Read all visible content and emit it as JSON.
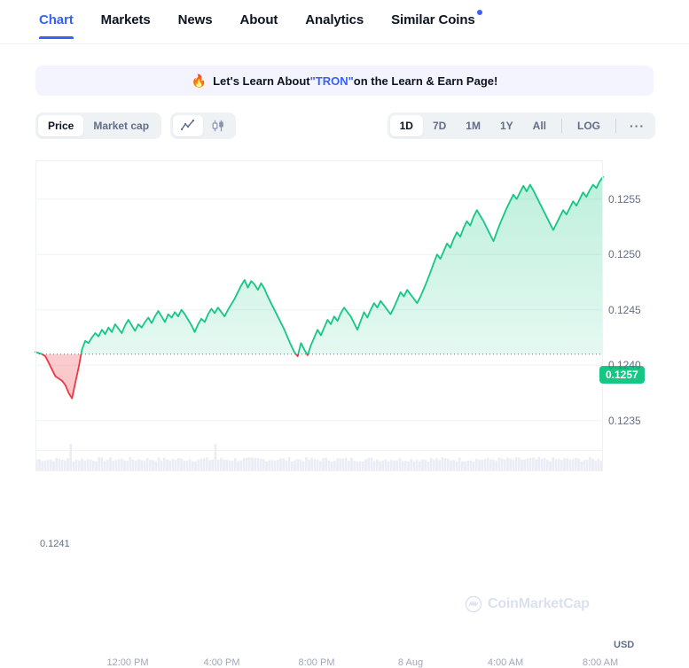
{
  "tabs": [
    {
      "label": "Chart",
      "active": true,
      "dot": false
    },
    {
      "label": "Markets",
      "active": false,
      "dot": false
    },
    {
      "label": "News",
      "active": false,
      "dot": false
    },
    {
      "label": "About",
      "active": false,
      "dot": false
    },
    {
      "label": "Analytics",
      "active": false,
      "dot": false
    },
    {
      "label": "Similar Coins",
      "active": false,
      "dot": true
    }
  ],
  "banner": {
    "icon": "flame-icon",
    "flame": "🔥",
    "text_before": "Let's Learn About ",
    "highlight": "\"TRON\"",
    "text_after": " on the Learn & Earn Page!"
  },
  "toolbar": {
    "metric_options": [
      {
        "label": "Price",
        "active": true
      },
      {
        "label": "Market cap",
        "active": false
      }
    ],
    "chart_type_options": [
      {
        "name": "line-chart-icon",
        "active": true
      },
      {
        "name": "candlestick-chart-icon",
        "active": false
      }
    ],
    "ranges": [
      {
        "label": "1D",
        "active": true
      },
      {
        "label": "7D",
        "active": false
      },
      {
        "label": "1M",
        "active": false
      },
      {
        "label": "1Y",
        "active": false
      },
      {
        "label": "All",
        "active": false
      }
    ],
    "log_label": "LOG",
    "more_label": "···"
  },
  "chart_data": {
    "type": "line",
    "title": "",
    "xlabel": "",
    "ylabel": "USD",
    "currency_label": "USD",
    "current_price_badge": "0.1257",
    "baseline_label": "0.1241",
    "baseline_value": 0.1241,
    "ylim": [
      0.12325,
      0.12585
    ],
    "grid": true,
    "legend_position": "none",
    "ytick_labels": [
      "0.1235",
      "0.1240",
      "0.1245",
      "0.1250",
      "0.1255"
    ],
    "ytick_values": [
      0.1235,
      0.124,
      0.1245,
      0.125,
      0.1255
    ],
    "xtick_labels": [
      "12:00 PM",
      "4:00 PM",
      "8:00 PM",
      "8 Aug",
      "4:00 AM",
      "8:00 AM"
    ],
    "xtick_positions": [
      144,
      250,
      357,
      463,
      570,
      677
    ],
    "line_color_up": "#16c784",
    "line_color_down": "#ea3943",
    "fill_color_up": "#16c784",
    "fill_color_down": "#ea3943",
    "watermark": "CoinMarketCap",
    "values": [
      0.12412,
      0.12411,
      0.1241,
      0.12408,
      0.12402,
      0.12396,
      0.1239,
      0.12388,
      0.12386,
      0.12382,
      0.12375,
      0.1237,
      0.12384,
      0.12398,
      0.12414,
      0.12422,
      0.1242,
      0.12425,
      0.12429,
      0.12426,
      0.12432,
      0.12428,
      0.12434,
      0.1243,
      0.12437,
      0.12433,
      0.12429,
      0.12436,
      0.12441,
      0.12436,
      0.12431,
      0.12437,
      0.12434,
      0.12439,
      0.12443,
      0.12438,
      0.12444,
      0.12449,
      0.12444,
      0.12439,
      0.12446,
      0.12443,
      0.12448,
      0.12444,
      0.1245,
      0.12446,
      0.12441,
      0.12436,
      0.1243,
      0.12437,
      0.12442,
      0.12439,
      0.12446,
      0.12451,
      0.12447,
      0.12452,
      0.12448,
      0.12444,
      0.1245,
      0.12455,
      0.1246,
      0.12466,
      0.12472,
      0.12477,
      0.1247,
      0.12476,
      0.12473,
      0.12468,
      0.12474,
      0.12469,
      0.12462,
      0.12456,
      0.1245,
      0.12444,
      0.12438,
      0.12432,
      0.12425,
      0.12418,
      0.12412,
      0.12408,
      0.1242,
      0.12414,
      0.12409,
      0.12418,
      0.12425,
      0.12432,
      0.12427,
      0.12434,
      0.12441,
      0.12437,
      0.12444,
      0.1244,
      0.12447,
      0.12452,
      0.12448,
      0.12444,
      0.12438,
      0.12432,
      0.1244,
      0.12448,
      0.12443,
      0.1245,
      0.12456,
      0.12452,
      0.12458,
      0.12454,
      0.1245,
      0.12446,
      0.12452,
      0.12459,
      0.12466,
      0.12462,
      0.12468,
      0.12464,
      0.1246,
      0.12456,
      0.12462,
      0.12469,
      0.12476,
      0.12484,
      0.12492,
      0.125,
      0.12496,
      0.12503,
      0.1251,
      0.12506,
      0.12514,
      0.1252,
      0.12516,
      0.12524,
      0.1253,
      0.12526,
      0.12534,
      0.1254,
      0.12535,
      0.1253,
      0.12524,
      0.12518,
      0.12512,
      0.1252,
      0.12528,
      0.12535,
      0.12542,
      0.12548,
      0.12554,
      0.1255,
      0.12556,
      0.12562,
      0.12557,
      0.12563,
      0.12558,
      0.12552,
      0.12546,
      0.1254,
      0.12534,
      0.12528,
      0.12522,
      0.12528,
      0.12534,
      0.1254,
      0.12536,
      0.12542,
      0.12548,
      0.12544,
      0.1255,
      0.12556,
      0.12552,
      0.12558,
      0.12563,
      0.1256,
      0.12566,
      0.1257
    ]
  }
}
